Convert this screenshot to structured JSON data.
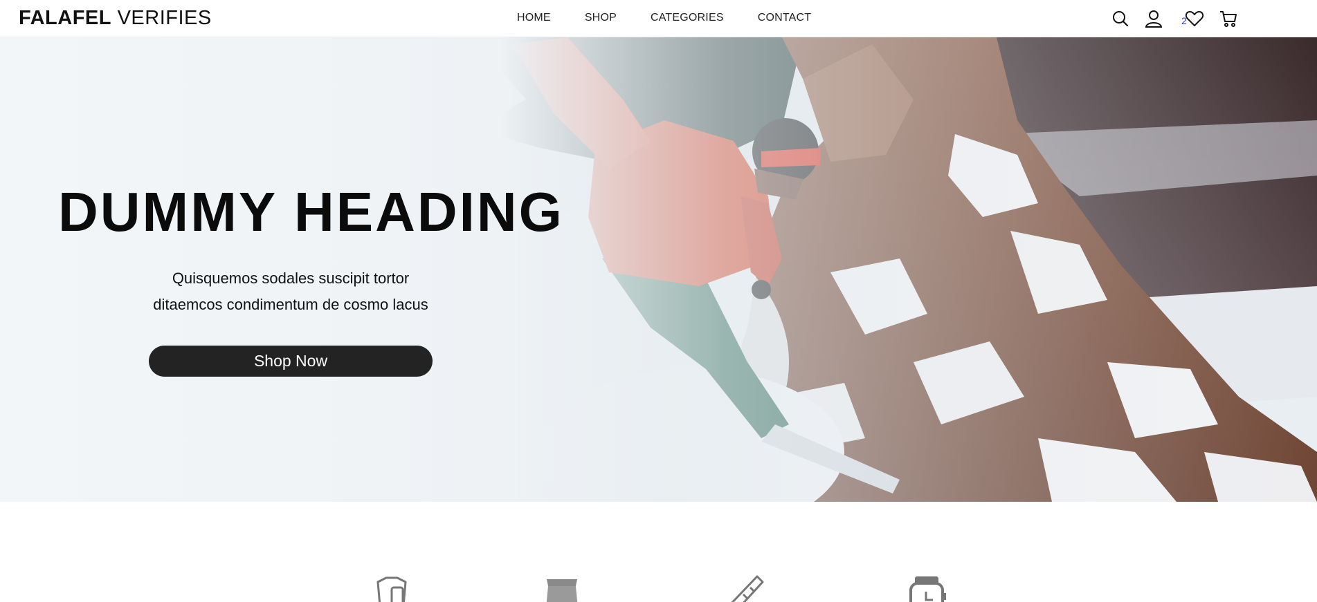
{
  "header": {
    "logo_bold": "FALAFEL",
    "logo_thin": "VERIFIES",
    "nav": [
      {
        "label": "HOME"
      },
      {
        "label": "SHOP"
      },
      {
        "label": "CATEGORIES"
      },
      {
        "label": "CONTACT"
      }
    ],
    "icons": [
      "search-icon",
      "user-icon",
      "heart-icon",
      "cart-icon"
    ],
    "wishlist_count": "2"
  },
  "hero": {
    "heading": "DUMMY HEADING",
    "subtitle_line1": "Quisquemos sodales suscipit tortor",
    "subtitle_line2": "ditaemcos condimentum de cosmo lacus",
    "button_label": "Shop Now",
    "image_subject": "snowboarder in orange jacket on snowy rocky mountain"
  },
  "categories": {
    "icons": [
      "shirt-phone-icon",
      "pants-icon",
      "snowboard-icon",
      "watch-icon"
    ]
  },
  "colors": {
    "button_bg": "#232323",
    "wishlist_badge": "#2b3fd6",
    "jacket": "#d9482a"
  }
}
